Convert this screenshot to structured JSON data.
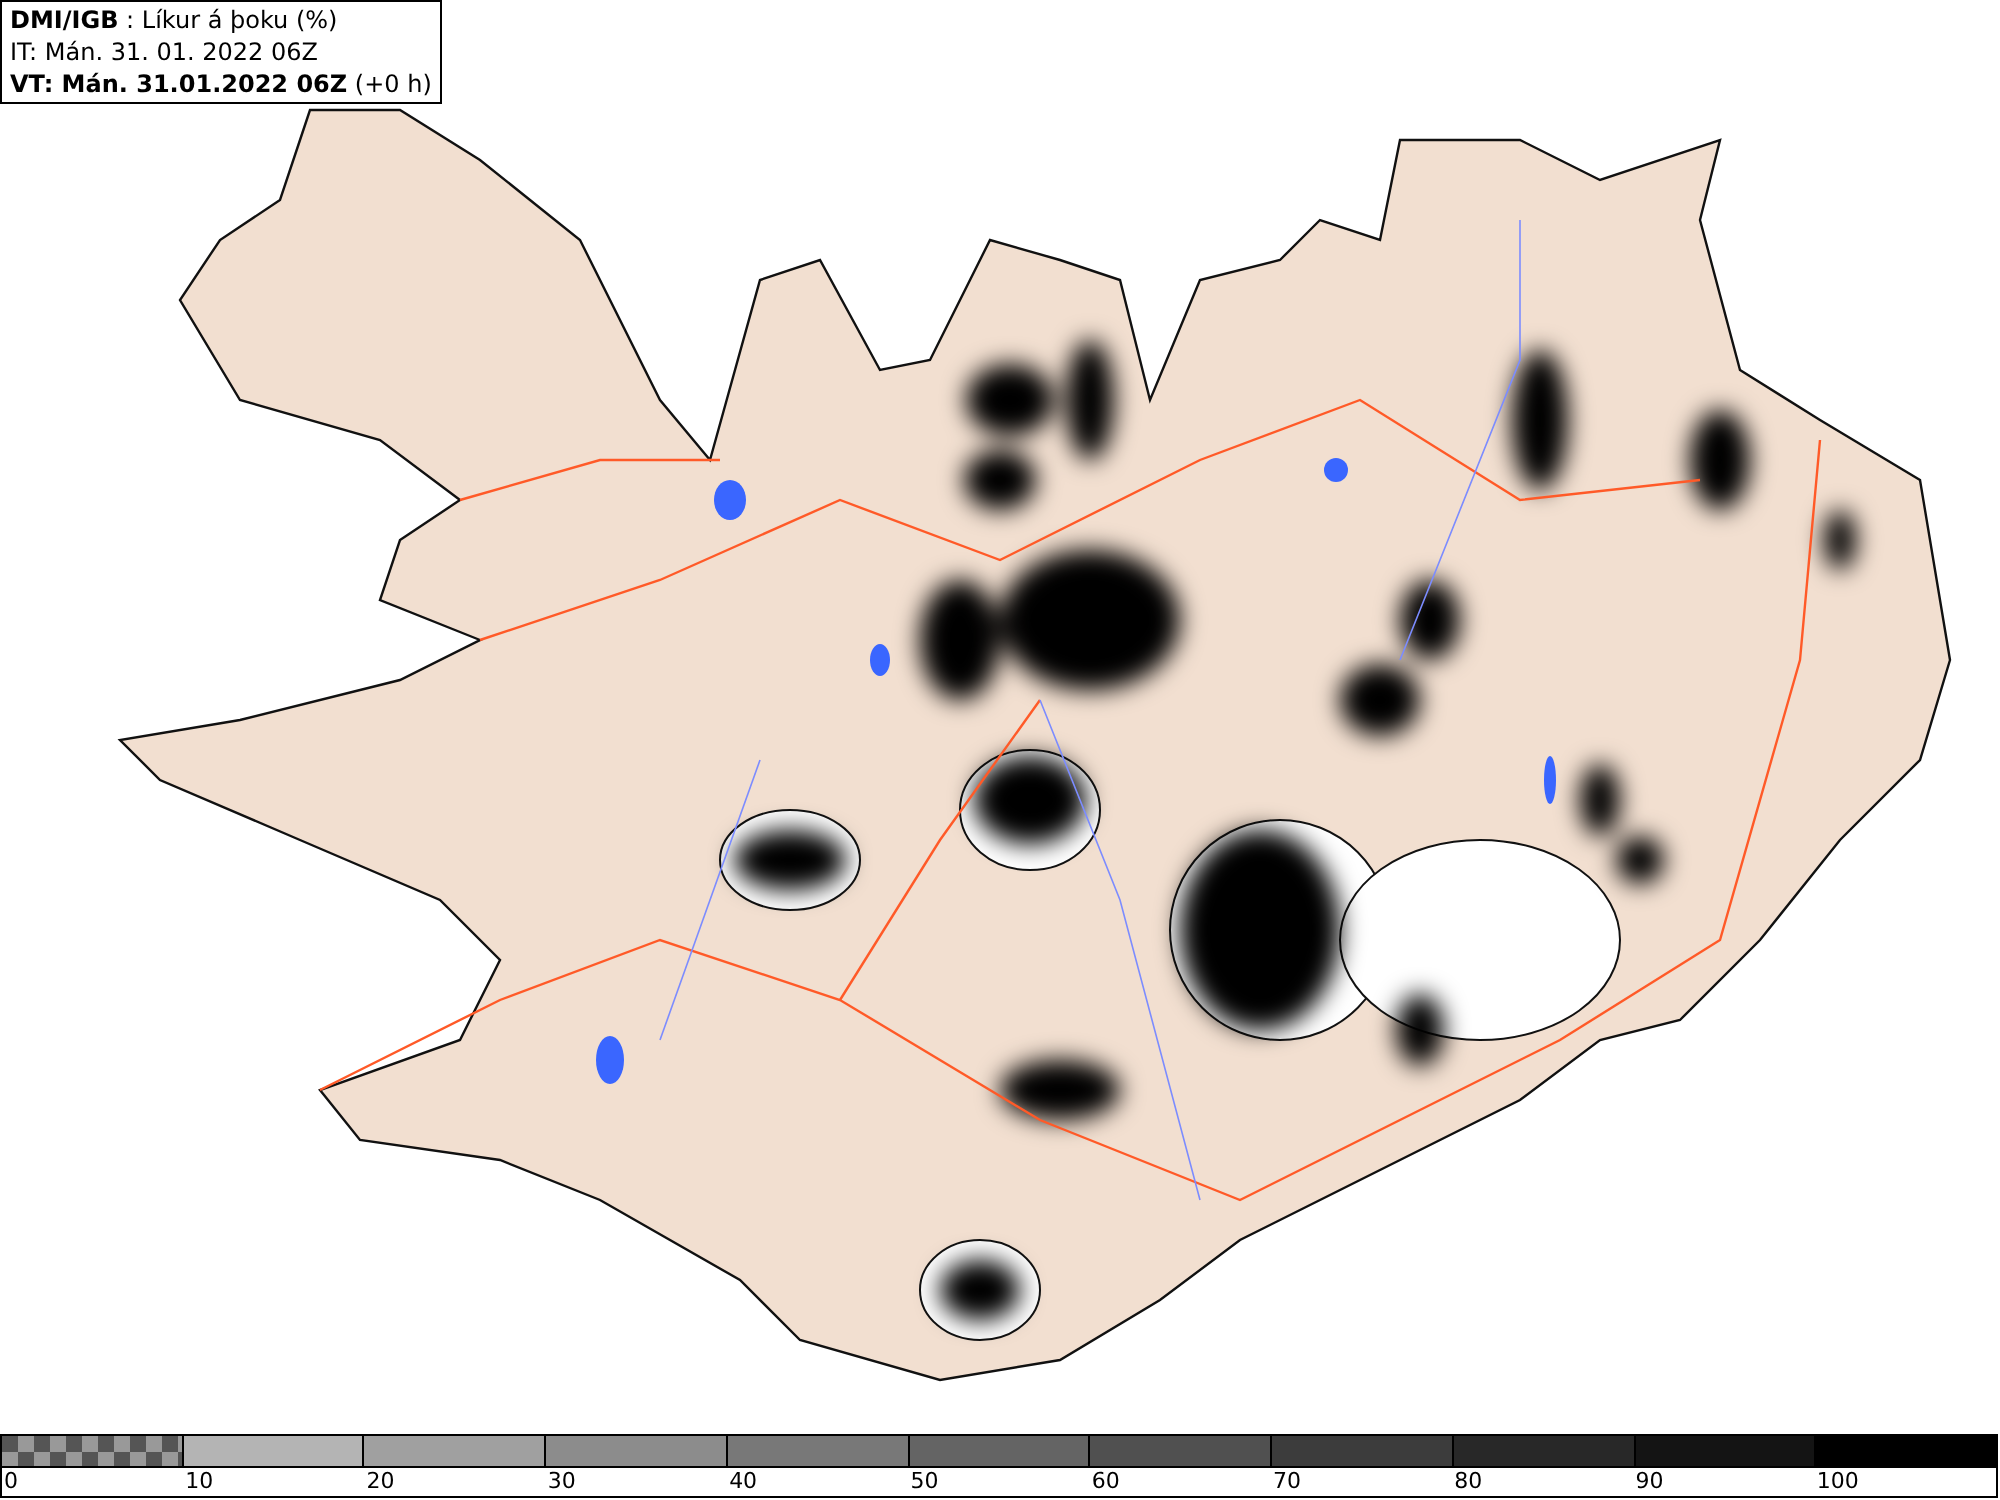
{
  "header": {
    "lines": [
      "**DMI/IGB** : Líkur á þoku (%)",
      "IT: Mán. 31. 01. 2022 06Z",
      "**VT: Mán. 31.01.2022 06Z** (+0 h)"
    ]
  },
  "legend": {
    "segments": [
      {
        "kind": "checker",
        "color": "#555555",
        "label": "0"
      },
      {
        "kind": "solid",
        "color": "#b4b4b4",
        "label": "10"
      },
      {
        "kind": "solid",
        "color": "#a0a0a0",
        "label": "20"
      },
      {
        "kind": "solid",
        "color": "#8c8c8c",
        "label": "30"
      },
      {
        "kind": "solid",
        "color": "#787878",
        "label": "40"
      },
      {
        "kind": "solid",
        "color": "#646464",
        "label": "50"
      },
      {
        "kind": "solid",
        "color": "#505050",
        "label": "60"
      },
      {
        "kind": "solid",
        "color": "#3c3c3c",
        "label": "70"
      },
      {
        "kind": "solid",
        "color": "#282828",
        "label": "80"
      },
      {
        "kind": "solid",
        "color": "#141414",
        "label": "90"
      },
      {
        "kind": "solid",
        "color": "#000000",
        "label": "100"
      }
    ]
  }
}
